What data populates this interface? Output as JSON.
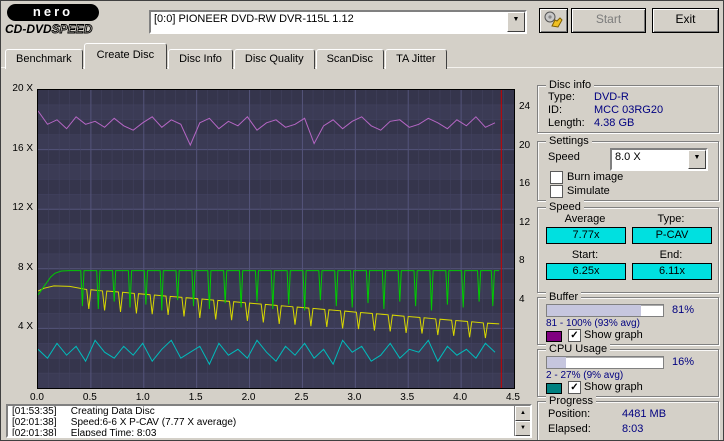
{
  "header": {
    "logo_main": "nero",
    "logo_sub_solid": "CD-DVD",
    "logo_sub_outline": "SPEED",
    "drive_select": "[0:0]  PIONEER DVD-RW  DVR-115L 1.12",
    "start_label": "Start",
    "exit_label": "Exit"
  },
  "icons": {
    "dropdown": "▼",
    "scroll_up": "▲",
    "scroll_down": "▼",
    "check": "✓"
  },
  "tabs": [
    {
      "label": "Benchmark",
      "active": false
    },
    {
      "label": "Create Disc",
      "active": true
    },
    {
      "label": "Disc Info",
      "active": false
    },
    {
      "label": "Disc Quality",
      "active": false
    },
    {
      "label": "ScanDisc",
      "active": false
    },
    {
      "label": "TA Jitter",
      "active": false
    }
  ],
  "chart_data": {
    "type": "line",
    "title": "",
    "xlabel": "",
    "ylabel": "",
    "xlim": [
      0,
      4.5
    ],
    "ylim_left": [
      0,
      20
    ],
    "x_ticks": [
      "0.0",
      "0.5",
      "1.0",
      "1.5",
      "2.0",
      "2.5",
      "3.0",
      "3.5",
      "4.0",
      "4.5"
    ],
    "y_ticks_left": [
      "20 X",
      "16 X",
      "12 X",
      "8 X",
      "4 X"
    ],
    "y_ticks_right": [
      "24",
      "20",
      "16",
      "12",
      "8",
      "4"
    ],
    "grid": true,
    "position_marker_x": 4.38,
    "marker_color": "#cc0000",
    "series": [
      {
        "name": "buffer",
        "unit": "%",
        "color": "#b566c4",
        "scale": 0.2,
        "x0": 0,
        "dx": 0.09,
        "values": [
          93,
          88.5,
          90,
          87,
          91,
          88.5,
          89.5,
          87.5,
          90.5,
          88,
          86.5,
          89,
          91,
          87.5,
          90,
          88.5,
          81.5,
          89,
          90.5,
          87,
          89.5,
          88,
          91,
          86.5,
          89,
          90,
          87.5,
          88.5,
          90.5,
          82,
          88,
          90,
          87,
          89.5,
          91,
          88,
          86.5,
          89.5,
          90,
          87.5,
          88.5,
          90.5,
          89,
          87,
          90,
          88,
          91,
          87.5,
          89
        ]
      },
      {
        "name": "cpu-usage",
        "unit": "%",
        "color": "#00bcbc",
        "scale": 0.2,
        "x0": 0,
        "dx": 0.09,
        "values": [
          13,
          10,
          15,
          11,
          14,
          9,
          16,
          12,
          10,
          14,
          11,
          15,
          9,
          13,
          16,
          10,
          12,
          14,
          8,
          15,
          11,
          13,
          10,
          16,
          12,
          9,
          14,
          11,
          15,
          10,
          13,
          8,
          16,
          12,
          14,
          9,
          11,
          15,
          10,
          13,
          12,
          16,
          9,
          14,
          11,
          13,
          10,
          15,
          12
        ]
      },
      {
        "name": "secondary-speed",
        "unit": "x",
        "color": "#d8d800",
        "scale": 1,
        "points": [
          [
            0,
            6.5
          ],
          [
            0.06,
            6.7
          ],
          [
            0.15,
            6.85
          ],
          [
            0.3,
            6.82
          ],
          [
            0.46,
            6.61
          ],
          [
            0.48,
            5.3
          ],
          [
            0.5,
            6.6
          ],
          [
            0.61,
            6.52
          ],
          [
            0.63,
            5.2
          ],
          [
            0.65,
            6.51
          ],
          [
            0.76,
            6.44
          ],
          [
            0.78,
            5.1
          ],
          [
            0.8,
            6.42
          ],
          [
            0.91,
            6.35
          ],
          [
            0.93,
            5.0
          ],
          [
            0.95,
            6.33
          ],
          [
            1.06,
            6.26
          ],
          [
            1.08,
            4.95
          ],
          [
            1.1,
            6.24
          ],
          [
            1.21,
            6.17
          ],
          [
            1.23,
            4.9
          ],
          [
            1.25,
            6.15
          ],
          [
            1.36,
            6.08
          ],
          [
            1.38,
            4.8
          ],
          [
            1.4,
            6.06
          ],
          [
            1.51,
            5.99
          ],
          [
            1.53,
            4.7
          ],
          [
            1.55,
            5.97
          ],
          [
            1.66,
            5.9
          ],
          [
            1.68,
            4.6
          ],
          [
            1.7,
            5.88
          ],
          [
            1.81,
            5.81
          ],
          [
            1.83,
            4.55
          ],
          [
            1.85,
            5.79
          ],
          [
            1.96,
            5.72
          ],
          [
            1.98,
            4.5
          ],
          [
            2.0,
            5.7
          ],
          [
            2.11,
            5.63
          ],
          [
            2.13,
            4.4
          ],
          [
            2.15,
            5.61
          ],
          [
            2.26,
            5.54
          ],
          [
            2.28,
            4.3
          ],
          [
            2.3,
            5.52
          ],
          [
            2.41,
            5.45
          ],
          [
            2.43,
            4.25
          ],
          [
            2.45,
            5.43
          ],
          [
            2.56,
            5.36
          ],
          [
            2.58,
            4.15
          ],
          [
            2.6,
            5.34
          ],
          [
            2.71,
            5.27
          ],
          [
            2.73,
            4.1
          ],
          [
            2.75,
            5.25
          ],
          [
            2.86,
            5.18
          ],
          [
            2.88,
            4.0
          ],
          [
            2.9,
            5.16
          ],
          [
            3.01,
            5.09
          ],
          [
            3.03,
            3.95
          ],
          [
            3.05,
            5.07
          ],
          [
            3.16,
            5.0
          ],
          [
            3.18,
            3.85
          ],
          [
            3.2,
            4.98
          ],
          [
            3.31,
            4.91
          ],
          [
            3.33,
            3.8
          ],
          [
            3.35,
            4.89
          ],
          [
            3.46,
            4.82
          ],
          [
            3.48,
            3.7
          ],
          [
            3.5,
            4.8
          ],
          [
            3.61,
            4.73
          ],
          [
            3.63,
            3.65
          ],
          [
            3.65,
            4.71
          ],
          [
            3.76,
            4.64
          ],
          [
            3.78,
            3.55
          ],
          [
            3.8,
            4.62
          ],
          [
            3.91,
            4.55
          ],
          [
            3.93,
            3.5
          ],
          [
            3.95,
            4.53
          ],
          [
            4.06,
            4.46
          ],
          [
            4.08,
            3.4
          ],
          [
            4.1,
            4.44
          ],
          [
            4.21,
            4.37
          ],
          [
            4.23,
            3.35
          ],
          [
            4.25,
            4.35
          ],
          [
            4.36,
            4.3
          ]
        ]
      },
      {
        "name": "write-speed",
        "unit": "x",
        "color": "#00cc00",
        "scale": 1,
        "points": [
          [
            0,
            6.25
          ],
          [
            0.03,
            6.55
          ],
          [
            0.06,
            6.85
          ],
          [
            0.09,
            7.15
          ],
          [
            0.12,
            7.45
          ],
          [
            0.16,
            7.7
          ],
          [
            0.22,
            7.85
          ],
          [
            0.3,
            7.88
          ],
          [
            0.405,
            7.88
          ],
          [
            0.42,
            5.5
          ],
          [
            0.435,
            7.88
          ],
          [
            0.555,
            7.88
          ],
          [
            0.57,
            5.3
          ],
          [
            0.585,
            7.88
          ],
          [
            0.705,
            7.88
          ],
          [
            0.72,
            5.8
          ],
          [
            0.735,
            7.88
          ],
          [
            0.855,
            7.88
          ],
          [
            0.87,
            5.4
          ],
          [
            0.885,
            7.88
          ],
          [
            1.005,
            7.88
          ],
          [
            1.02,
            5.6
          ],
          [
            1.035,
            7.88
          ],
          [
            1.155,
            7.88
          ],
          [
            1.17,
            5.2
          ],
          [
            1.185,
            7.88
          ],
          [
            1.305,
            7.88
          ],
          [
            1.32,
            5.9
          ],
          [
            1.335,
            7.88
          ],
          [
            1.455,
            7.88
          ],
          [
            1.47,
            5.5
          ],
          [
            1.485,
            7.88
          ],
          [
            1.605,
            7.88
          ],
          [
            1.62,
            5.3
          ],
          [
            1.635,
            7.88
          ],
          [
            1.755,
            7.88
          ],
          [
            1.77,
            5.7
          ],
          [
            1.785,
            7.88
          ],
          [
            1.905,
            7.88
          ],
          [
            1.92,
            5.4
          ],
          [
            1.935,
            7.88
          ],
          [
            2.055,
            7.88
          ],
          [
            2.07,
            5.8
          ],
          [
            2.085,
            7.88
          ],
          [
            2.205,
            7.88
          ],
          [
            2.22,
            5.3
          ],
          [
            2.235,
            7.88
          ],
          [
            2.355,
            7.88
          ],
          [
            2.37,
            5.6
          ],
          [
            2.385,
            7.88
          ],
          [
            2.505,
            7.88
          ],
          [
            2.52,
            5.2
          ],
          [
            2.535,
            7.88
          ],
          [
            2.655,
            7.88
          ],
          [
            2.67,
            5.9
          ],
          [
            2.685,
            7.88
          ],
          [
            2.805,
            7.88
          ],
          [
            2.82,
            5.5
          ],
          [
            2.835,
            7.88
          ],
          [
            2.955,
            7.88
          ],
          [
            2.97,
            5.4
          ],
          [
            2.985,
            7.88
          ],
          [
            3.105,
            7.88
          ],
          [
            3.12,
            5.7
          ],
          [
            3.135,
            7.88
          ],
          [
            3.255,
            7.88
          ],
          [
            3.27,
            5.3
          ],
          [
            3.285,
            7.88
          ],
          [
            3.405,
            7.88
          ],
          [
            3.42,
            5.8
          ],
          [
            3.435,
            7.88
          ],
          [
            3.555,
            7.88
          ],
          [
            3.57,
            5.5
          ],
          [
            3.585,
            7.88
          ],
          [
            3.705,
            7.88
          ],
          [
            3.72,
            5.2
          ],
          [
            3.735,
            7.88
          ],
          [
            3.855,
            7.88
          ],
          [
            3.87,
            5.6
          ],
          [
            3.885,
            7.88
          ],
          [
            4.005,
            7.88
          ],
          [
            4.02,
            5.4
          ],
          [
            4.035,
            7.88
          ],
          [
            4.155,
            7.88
          ],
          [
            4.17,
            5.8
          ],
          [
            4.185,
            7.88
          ],
          [
            4.285,
            7.88
          ],
          [
            4.3,
            5.5
          ],
          [
            4.315,
            7.88
          ],
          [
            4.36,
            7.88
          ]
        ]
      }
    ]
  },
  "sidebar": {
    "disc_info": {
      "title": "Disc info",
      "rows": [
        {
          "label": "Type:",
          "value": "DVD-R"
        },
        {
          "label": "ID:",
          "value": "MCC 03RG20"
        },
        {
          "label": "Length:",
          "value": "4.38 GB"
        }
      ]
    },
    "settings": {
      "title": "Settings",
      "speed_label": "Speed",
      "speed_value": "8.0 X",
      "checkboxes": [
        {
          "label": "Burn image",
          "checked": false
        },
        {
          "label": "Simulate",
          "checked": false
        }
      ]
    },
    "speed": {
      "title": "Speed",
      "average_label": "Average",
      "type_label": "Type:",
      "average": "7.77x",
      "type": "P-CAV",
      "start_label": "Start:",
      "end_label": "End:",
      "start": "6.25x",
      "end": "6.11x",
      "box_color": "#00e0e0"
    },
    "buffer": {
      "title": "Buffer",
      "percent": "81%",
      "fill": 81,
      "range": "81 - 100% (93% avg)",
      "swatch": "#800080",
      "show_graph": "Show graph",
      "checked": true
    },
    "cpu": {
      "title": "CPU Usage",
      "percent": "16%",
      "fill": 16,
      "range": "2 - 27% (9% avg)",
      "swatch": "#008080",
      "show_graph": "Show graph",
      "checked": true
    },
    "progress": {
      "title": "Progress",
      "position_label": "Position:",
      "position": "4481 MB",
      "elapsed_label": "Elapsed:",
      "elapsed": "8:03"
    }
  },
  "log": {
    "lines": [
      {
        "time": "[01:53:35]",
        "text": "Creating Data Disc"
      },
      {
        "time": "[02:01:38]",
        "text": "Speed:6-6 X P-CAV (7.77 X average)"
      },
      {
        "time": "[02:01:38]",
        "text": "Elapsed Time: 8:03"
      }
    ]
  }
}
